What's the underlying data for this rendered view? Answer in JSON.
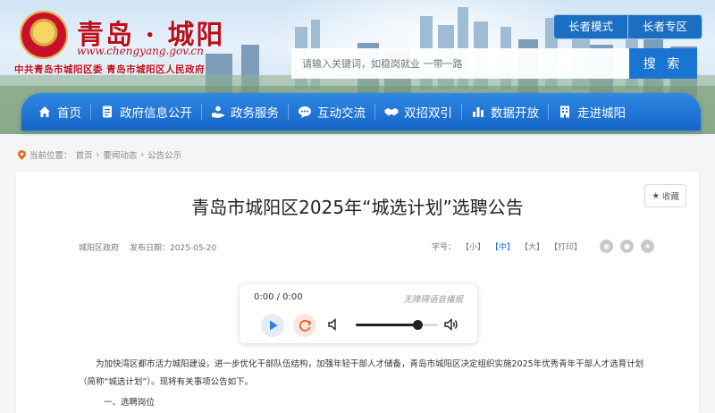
{
  "header": {
    "site_title": "青岛 · 城阳",
    "site_url": "www.chengyang.gov.cn",
    "site_org": "中共青岛市城阳区委    青岛市城阳区人民政府",
    "elder_mode": "长者模式",
    "elder_zone": "长者专区",
    "search_placeholder": "请输入关键词，如稳岗就业 一带一路",
    "search_button": "搜 索"
  },
  "nav": {
    "items": [
      {
        "label": "首页",
        "icon": "home-icon"
      },
      {
        "label": "政府信息公开",
        "icon": "document-icon"
      },
      {
        "label": "政务服务",
        "icon": "hand-service-icon"
      },
      {
        "label": "互动交流",
        "icon": "chat-icon"
      },
      {
        "label": "双招双引",
        "icon": "handshake-icon"
      },
      {
        "label": "数据开放",
        "icon": "bar-chart-icon"
      },
      {
        "label": "走进城阳",
        "icon": "building-icon"
      }
    ]
  },
  "breadcrumb": {
    "prefix": "当前位置：",
    "items": [
      "首页",
      "要闻动态",
      "公告公示"
    ],
    "separator": "›"
  },
  "article": {
    "favorite": "收藏",
    "title": "青岛市城阳区2025年“城选计划”选聘公告",
    "source": "城阳区政府",
    "date_label": "发布日期：",
    "date": "2025-05-20",
    "font_size_label": "字号：",
    "font_sizes": [
      "【小】",
      "【中】",
      "【大】",
      "【打印】"
    ],
    "paragraph1": "为加快湾区都市活力城阳建设，进一步优化干部队伍结构，加强年轻干部人才储备，青岛市城阳区决定组织实施2025年优秀青年干部人才选育计划（简称“城选计划”）。现将有关事项公告如下。",
    "paragraph2": "一、选聘岗位"
  },
  "player": {
    "time": "0:00 / 0:00",
    "note": "无障碍语音播报",
    "volume": 0.75
  }
}
